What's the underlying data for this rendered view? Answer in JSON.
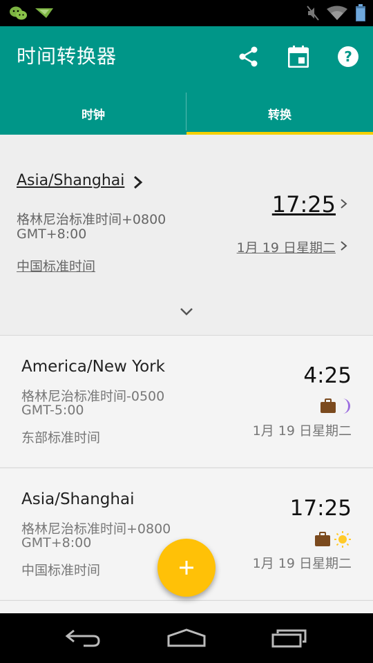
{
  "status_bar": {
    "left_icons": [
      "wechat-icon",
      "bird-notification-icon"
    ],
    "right_icons": [
      "muted-icon",
      "wifi-icon",
      "battery-icon"
    ]
  },
  "app_bar": {
    "title": "时间转换器",
    "actions": [
      "share-icon",
      "calendar-icon",
      "help-icon"
    ],
    "color": "#009688"
  },
  "tabs": [
    {
      "label": "时钟",
      "selected": false
    },
    {
      "label": "转换",
      "selected": true
    }
  ],
  "tab_indicator_color": "#f5d000",
  "source": {
    "zone": "Asia/Shanghai",
    "offset": "格林尼治标准时间+0800",
    "gmt": "GMT+8:00",
    "name": "中国标准时间",
    "time": "17:25",
    "date": "1月 19 日星期二"
  },
  "cards": [
    {
      "zone": "America/New York",
      "offset": "格林尼治标准时间-0500",
      "gmt": "GMT-5:00",
      "name": "东部标准时间",
      "time": "4:25",
      "date": "1月 19 日星期二",
      "icons": [
        "briefcase-icon",
        "moon-icon"
      ]
    },
    {
      "zone": "Asia/Shanghai",
      "offset": "格林尼治标准时间+0800",
      "gmt": "GMT+8:00",
      "name": "中国标准时间",
      "time": "17:25",
      "date": "1月 19 日星期二",
      "icons": [
        "briefcase-icon",
        "sun-icon"
      ]
    }
  ],
  "fab": {
    "icon": "plus-icon",
    "color": "#ffc107"
  },
  "nav_bar": {
    "buttons": [
      "back-icon",
      "home-icon",
      "recents-icon"
    ]
  }
}
